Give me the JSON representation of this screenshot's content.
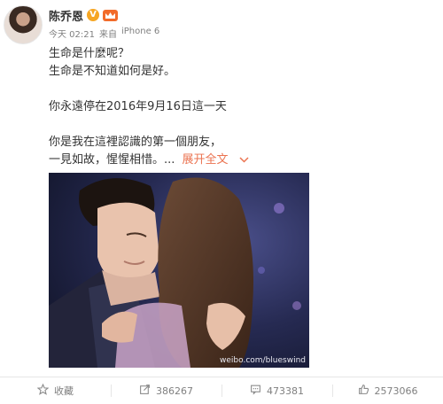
{
  "post": {
    "username": "陈乔恩",
    "verified_badge": "V",
    "timestamp": "今天 02:21",
    "source_prefix": "来自",
    "source": "iPhone 6",
    "lines": [
      "生命是什麼呢？",
      "生命是不知道如何是好。",
      "",
      "你永遠停在2016年9月16日這一天",
      "",
      "你是我在這裡認識的第一個朋友，"
    ],
    "last_line": "一見如故，惺惺相惜。...",
    "expand_label": "展开全文",
    "expand_icon": "chevron-down-icon",
    "image_watermark": "weibo.com/blueswind"
  },
  "actions": [
    {
      "label": "收藏",
      "icon": "star-icon"
    },
    {
      "label": "386267",
      "icon": "share-icon"
    },
    {
      "label": "473381",
      "icon": "comment-icon"
    },
    {
      "label": "2573066",
      "icon": "like-icon"
    }
  ],
  "colors": {
    "accent": "#eb7350",
    "text": "#333333",
    "muted": "#808080",
    "vip": "#f26b2a",
    "verified": "#f6a623"
  }
}
